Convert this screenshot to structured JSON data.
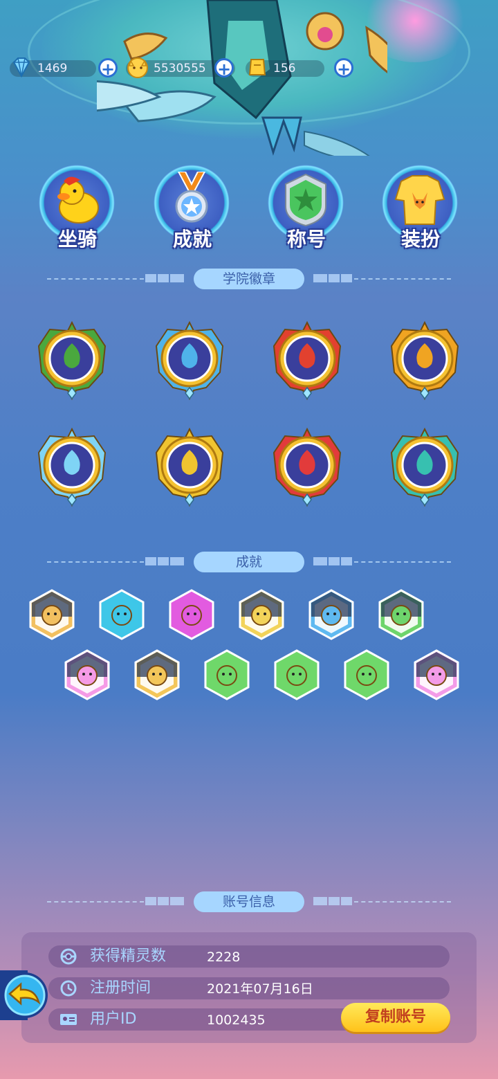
{
  "currencies": [
    {
      "icon": "diamond-icon",
      "value": "1469"
    },
    {
      "icon": "cat-coin-icon",
      "value": "5530555"
    },
    {
      "icon": "ticket-icon",
      "value": "156"
    }
  ],
  "nav": [
    {
      "label": "坐骑",
      "icon": "duck-icon"
    },
    {
      "label": "成就",
      "icon": "medal-icon"
    },
    {
      "label": "称号",
      "icon": "star-emblem-icon"
    },
    {
      "label": "装扮",
      "icon": "fox-sweater-icon"
    }
  ],
  "sections": {
    "academy_badges": "学院徽章",
    "achievements": "成就",
    "account_info": "账号信息"
  },
  "academy_badges": [
    {
      "icon": "leaf-badge-icon",
      "color": "#4aa83e"
    },
    {
      "icon": "wind-badge-icon",
      "color": "#4fb3ea"
    },
    {
      "icon": "fire-badge-icon",
      "color": "#e2412f"
    },
    {
      "icon": "sun-badge-icon",
      "color": "#f0a422"
    },
    {
      "icon": "snowflake-badge-icon",
      "color": "#7fd4f5"
    },
    {
      "icon": "thunder-badge-icon",
      "color": "#f0c430"
    },
    {
      "icon": "flame-wing-badge-icon",
      "color": "#e23b3b"
    },
    {
      "icon": "feather-badge-icon",
      "color": "#37c0b0"
    }
  ],
  "achievements": [
    {
      "icon": "fox-creature-icon",
      "color": "#f2c060",
      "unlocked": false
    },
    {
      "icon": "star-wings-icon",
      "color": "#3ec6e8",
      "unlocked": true
    },
    {
      "icon": "dice-icon",
      "color": "#e25be0",
      "unlocked": true
    },
    {
      "icon": "monster-gold-icon",
      "color": "#f2d35a",
      "unlocked": false
    },
    {
      "icon": "chick-icon",
      "color": "#5fb9f0",
      "unlocked": false
    },
    {
      "icon": "bunny-medal-icon",
      "color": "#6ed46c",
      "unlocked": false
    },
    {
      "icon": "castle-wings-icon",
      "color": "#f59be6",
      "unlocked": false
    },
    {
      "icon": "sword-icon",
      "color": "#f3c65a",
      "unlocked": false
    },
    {
      "icon": "balls-icon",
      "color": "#6fd86a",
      "unlocked": true
    },
    {
      "icon": "gold-coin-icon",
      "color": "#6fd86a",
      "unlocked": true
    },
    {
      "icon": "angry-kid-icon",
      "color": "#6fd86a",
      "unlocked": true
    },
    {
      "icon": "laughing-man-icon",
      "color": "#f39ce8",
      "unlocked": false
    }
  ],
  "account": {
    "spirits_label": "获得精灵数",
    "spirits_value": "2228",
    "register_label": "注册时间",
    "register_value": "2021年07月16日",
    "uid_label": "用户ID",
    "uid_value": "1002435",
    "copy_button": "复制账号"
  },
  "colors": {
    "accent_yellow": "#ffcf2e",
    "section_pill": "#a6d6ff",
    "label_blue": "#a9d6ff"
  }
}
